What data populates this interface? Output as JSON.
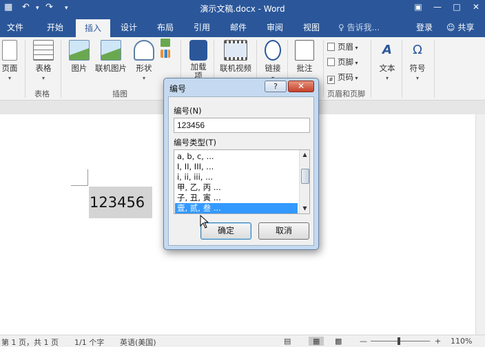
{
  "title_bar": {
    "document_title": "演示文稿.docx - Word",
    "quick_access": [
      "save-icon",
      "undo-icon",
      "redo-icon",
      "customize-icon"
    ],
    "window_controls": [
      "ribbon-display-icon",
      "minimize-icon",
      "maximize-icon",
      "close-icon"
    ]
  },
  "tabs": [
    "文件",
    "开始",
    "插入",
    "设计",
    "布局",
    "引用",
    "邮件",
    "审阅",
    "视图"
  ],
  "active_tab": "插入",
  "tell_me": "♀ 告诉我...",
  "sign_in": "登录",
  "share": "共享",
  "ribbon": {
    "pages": "页面",
    "table": "表格",
    "pictures": "图片",
    "online_pictures": "联机图片",
    "shapes": "形状",
    "addins": "加载\n项",
    "online_video": "联机视频",
    "links": "链接",
    "comment": "批注",
    "header": "页眉",
    "footer": "页脚",
    "page_number": "页码",
    "text": "文本",
    "symbols": "符号",
    "group_table": "表格",
    "group_illustrations": "插图",
    "group_header_footer": "页眉和页脚"
  },
  "document": {
    "field_text": "123456"
  },
  "dialog": {
    "title": "编号",
    "help": "?",
    "close": "✕",
    "number_label": "编号(N)",
    "number_value": "123456",
    "type_label": "编号类型(T)",
    "options": [
      "a, b, c, ...",
      "I, II, III, ...",
      "i, ii, iii, ...",
      "甲, 乙, 丙 ...",
      "子, 丑, 寅 ...",
      "壹, 贰, 叁 ..."
    ],
    "selected_index": 5,
    "ok": "确定",
    "cancel": "取消"
  },
  "status_bar": {
    "page": "第 1 页，共 1 页",
    "words": "1/1 个字",
    "language": "英语(美国)",
    "zoom": "110%"
  },
  "colors": {
    "accent": "#2b579a",
    "selection": "#3399ff",
    "dialog_frame": "#c5daf0"
  }
}
